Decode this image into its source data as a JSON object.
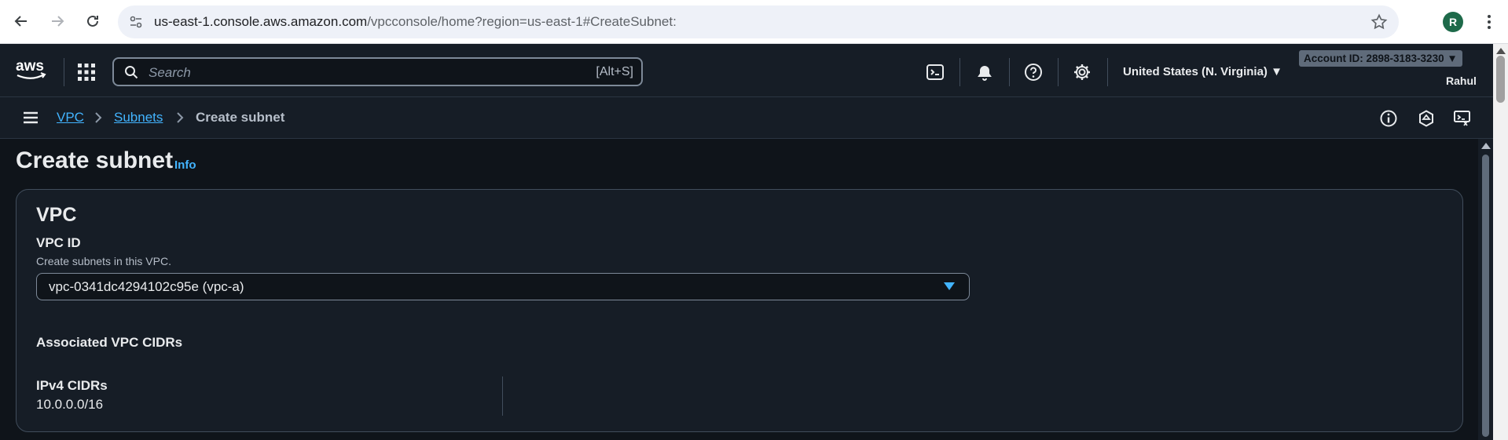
{
  "browser": {
    "url_host": "us-east-1.console.aws.amazon.com",
    "url_path": "/vpcconsole/home?region=us-east-1#CreateSubnet:",
    "profile_initial": "R"
  },
  "aws_nav": {
    "logo_text": "aws",
    "search_placeholder": "Search",
    "search_shortcut": "[Alt+S]",
    "region": "United States (N. Virginia) ▼",
    "account_id": "Account ID: 2898-3183-3230 ▼",
    "user": "Rahul"
  },
  "breadcrumb": {
    "items": [
      {
        "label": "VPC"
      },
      {
        "label": "Subnets"
      },
      {
        "label": "Create subnet"
      }
    ]
  },
  "page": {
    "title": "Create subnet",
    "info": "Info"
  },
  "vpc_panel": {
    "title": "VPC",
    "vpc_id_label": "VPC ID",
    "vpc_id_desc": "Create subnets in this VPC.",
    "vpc_id_value": "vpc-0341dc4294102c95e (vpc-a)",
    "assoc_heading": "Associated VPC CIDRs",
    "ipv4_label": "IPv4 CIDRs",
    "ipv4_value": "10.0.0.0/16"
  }
}
